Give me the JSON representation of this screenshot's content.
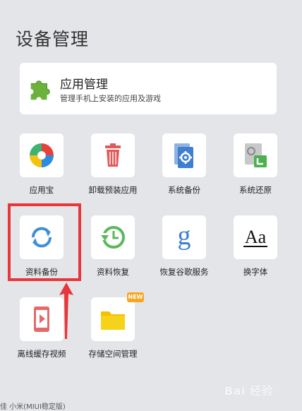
{
  "page": {
    "title": "设备管理"
  },
  "app_manager": {
    "title": "应用管理",
    "subtitle": "管理手机上安装的应用及游戏",
    "icon": "puzzle-icon"
  },
  "tiles": [
    {
      "label": "应用宝",
      "icon": "yingyongbao-icon"
    },
    {
      "label": "卸载预装应用",
      "icon": "trash-icon"
    },
    {
      "label": "系统备份",
      "icon": "system-backup-icon"
    },
    {
      "label": "系统还原",
      "icon": "system-restore-icon"
    },
    {
      "label": "资料备份",
      "icon": "sync-icon"
    },
    {
      "label": "资料恢复",
      "icon": "history-icon"
    },
    {
      "label": "恢复谷歌服务",
      "icon": "google-icon"
    },
    {
      "label": "换字体",
      "icon": "font-icon"
    },
    {
      "label": "离线缓存视频",
      "icon": "video-icon"
    },
    {
      "label": "存储空间管理",
      "icon": "folder-icon"
    }
  ],
  "badges": {
    "new": "NEW"
  },
  "font_icon_text": "Aa",
  "google_icon_text": "g",
  "bottom": {
    "text": "佳  小米(MIUI稳定版)"
  },
  "watermark": {
    "text": "Bai 经验"
  },
  "colors": {
    "background": "#e4e5e9",
    "highlight": "#e8363a",
    "badge": "#f5a623"
  }
}
